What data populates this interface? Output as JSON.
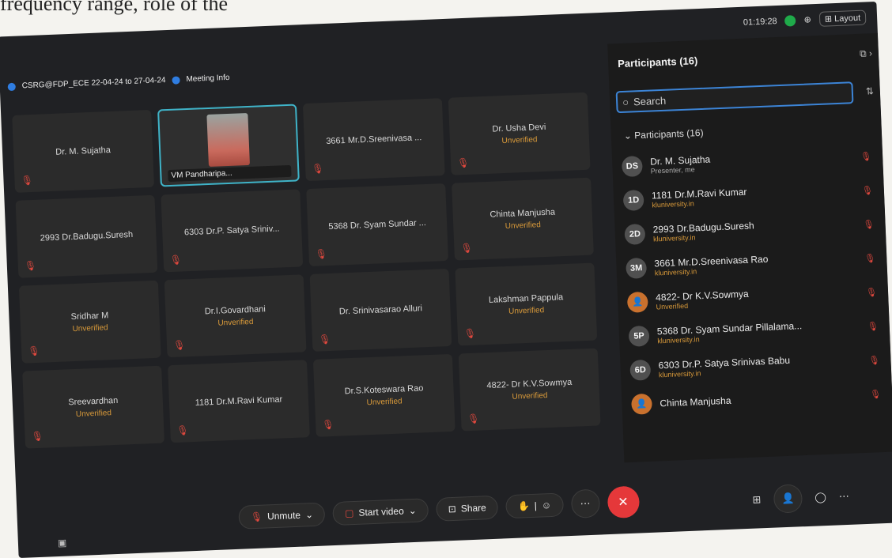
{
  "background_text": "frequency range, role of the",
  "topbar": {
    "timer": "01:19:28",
    "layout_label": "Layout"
  },
  "meeting": {
    "title": "CSRG@FDP_ECE 22-04-24 to 27-04-24",
    "info_label": "Meeting Info"
  },
  "tiles": [
    {
      "name": "Dr. M. Sujatha",
      "status": ""
    },
    {
      "name": "VM Pandharipa...",
      "status": "",
      "video": true
    },
    {
      "name": "3661 Mr.D.Sreenivasa ...",
      "status": ""
    },
    {
      "name": "Dr. Usha Devi",
      "status": "Unverified"
    },
    {
      "name": "2993 Dr.Badugu.Suresh",
      "status": ""
    },
    {
      "name": "6303 Dr.P. Satya Sriniv...",
      "status": ""
    },
    {
      "name": "5368 Dr. Syam Sundar ...",
      "status": ""
    },
    {
      "name": "Chinta Manjusha",
      "status": "Unverified"
    },
    {
      "name": "Sridhar M",
      "status": "Unverified"
    },
    {
      "name": "Dr.I.Govardhani",
      "status": "Unverified"
    },
    {
      "name": "Dr. Srinivasarao Alluri",
      "status": ""
    },
    {
      "name": "Lakshman Pappula",
      "status": "Unverified"
    },
    {
      "name": "Sreevardhan",
      "status": "Unverified"
    },
    {
      "name": "1181 Dr.M.Ravi Kumar",
      "status": ""
    },
    {
      "name": "Dr.S.Koteswara Rao",
      "status": "Unverified"
    },
    {
      "name": "4822- Dr K.V.Sowmya",
      "status": "Unverified"
    }
  ],
  "panel": {
    "title": "Participants (16)",
    "search_placeholder": "Search",
    "section_label": "Participants (16)",
    "participants": [
      {
        "initials": "DS",
        "name": "Dr. M. Sujatha",
        "sub": "Presenter, me",
        "sub_style": "gray"
      },
      {
        "initials": "1D",
        "name": "1181 Dr.M.Ravi Kumar",
        "sub": "kluniversity.in"
      },
      {
        "initials": "2D",
        "name": "2993 Dr.Badugu.Suresh",
        "sub": "kluniversity.in"
      },
      {
        "initials": "3M",
        "name": "3661 Mr.D.Sreenivasa Rao",
        "sub": "kluniversity.in"
      },
      {
        "initials": "",
        "name": "4822- Dr K.V.Sowmya",
        "sub": "Unverified",
        "orange": true
      },
      {
        "initials": "5P",
        "name": "5368 Dr. Syam Sundar Pillalama...",
        "sub": "kluniversity.in"
      },
      {
        "initials": "6D",
        "name": "6303 Dr.P. Satya Srinivas Babu",
        "sub": "kluniversity.in"
      },
      {
        "initials": "",
        "name": "Chinta Manjusha",
        "sub": "",
        "orange": true
      }
    ]
  },
  "toolbar": {
    "unmute": "Unmute",
    "start_video": "Start video",
    "share": "Share"
  },
  "colors": {
    "accent": "#3c84d6",
    "end_call": "#e5383a",
    "unverified": "#d99a3a",
    "muted": "#e0483e"
  }
}
